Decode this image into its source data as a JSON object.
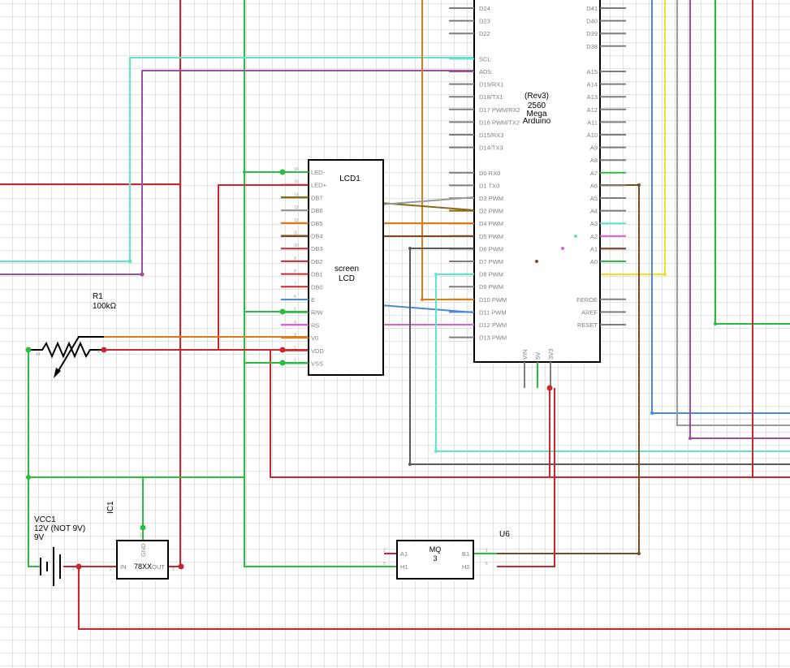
{
  "arduino": {
    "title_lines": [
      "(Rev3)",
      "2560",
      "Mega",
      "Arduino"
    ],
    "left_pins": [
      "D24",
      "D23",
      "D22",
      "",
      "SCL",
      "ADS",
      "D19/RX1",
      "D18/TX1",
      "D17 PWM/RX2",
      "D16 PWM/TX2",
      "D15/RX3",
      "D14/TX3",
      "",
      "D0 RX0",
      "D1 TX0",
      "D3 PWM",
      "D2 PWM",
      "D4 PWM",
      "D5 PWM",
      "D6 PWM",
      "D7 PWM",
      "D8 PWM",
      "D9 PWM",
      "D10 PWM",
      "D11 PWM",
      "D12 PWM",
      "D13 PWM"
    ],
    "right_pins": [
      "D41",
      "D40",
      "D39",
      "D38",
      "",
      "A15",
      "A14",
      "A13",
      "A12",
      "A11",
      "A10",
      "A9",
      "A8",
      "A7",
      "A6",
      "A5",
      "A4",
      "A3",
      "A2",
      "A1",
      "A0",
      "",
      "",
      "FEROE",
      "AREF",
      "RESET"
    ],
    "bottom_pins": [
      "VIN",
      "5V",
      "3V3"
    ]
  },
  "lcd": {
    "name": "LCD1",
    "type_lines": [
      "screen",
      "LCD"
    ],
    "pins": [
      {
        "num": "16",
        "label": "LED-"
      },
      {
        "num": "15",
        "label": "LED+"
      },
      {
        "num": "14",
        "label": "DB7"
      },
      {
        "num": "13",
        "label": "DB6"
      },
      {
        "num": "12",
        "label": "DB5"
      },
      {
        "num": "11",
        "label": "DB4"
      },
      {
        "num": "10",
        "label": "DB3"
      },
      {
        "num": "9",
        "label": "DB2"
      },
      {
        "num": "8",
        "label": "DB1"
      },
      {
        "num": "7",
        "label": "DB0"
      },
      {
        "num": "6",
        "label": "E"
      },
      {
        "num": "5",
        "label": "R/W"
      },
      {
        "num": "4",
        "label": "RS"
      },
      {
        "num": "3",
        "label": "V0"
      },
      {
        "num": "2",
        "label": "VDD"
      },
      {
        "num": "1",
        "label": "VSS"
      }
    ]
  },
  "r1": {
    "name": "R1",
    "value": "100kΩ",
    "pin_left": "14",
    "pin_right": "4"
  },
  "vcc1": {
    "name": "VCC1",
    "voltage_label": "12V (NOT 9V)",
    "value": "9V",
    "pin_right": "2"
  },
  "ic1": {
    "name": "IC1",
    "part": "78XX",
    "pin_in": "IN",
    "pin_out": "OUT",
    "pin_gnd": "GND",
    "num_in": "2",
    "num_out": "3",
    "num_gnd": "1"
  },
  "u6": {
    "name": "U6",
    "part_lines": [
      "MQ",
      "3"
    ],
    "pins_left": [
      "A1",
      "H1"
    ],
    "pins_right": [
      "B1",
      "H2"
    ],
    "nums_left": [
      "2",
      "5"
    ],
    "nums_right": [
      "1",
      "6"
    ]
  },
  "colors": {
    "red": "#c8282d",
    "green": "#2bbd40",
    "orange": "#e07a14",
    "brown": "#7a4a1e",
    "olive": "#8b6914",
    "cyan": "#5ee6c8",
    "purple": "#9c4f9c",
    "magenta": "#e060d8",
    "blue": "#4a8ad0",
    "gray": "#999999",
    "darkgray": "#595959",
    "yellow": "#f0e020"
  }
}
